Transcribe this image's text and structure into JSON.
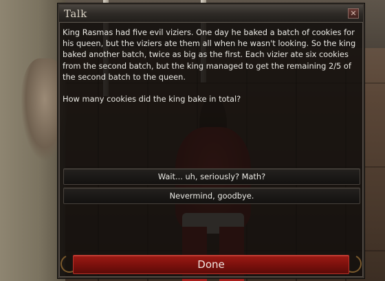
{
  "dialog": {
    "title": "Talk",
    "close_icon": "close-icon",
    "text_paragraphs": [
      "King Rasmas had five evil viziers. One day he baked a batch of cookies for his queen, but the viziers ate them all when he wasn't looking. So the king baked another batch, twice as big as the first. Each vizier ate six cookies from the second batch, but the king managed to get the remaining 2/5 of the second batch to the queen.",
      "How many cookies did the king bake in total?"
    ],
    "options": [
      {
        "label": "Wait... uh, seriously? Math?"
      },
      {
        "label": "Nevermind, goodbye."
      }
    ],
    "done_label": "Done"
  },
  "colors": {
    "panel_bg": "#120f0d",
    "text": "#ecebe6",
    "done_button": "#7d110d",
    "title_text": "#d9d2c4"
  }
}
